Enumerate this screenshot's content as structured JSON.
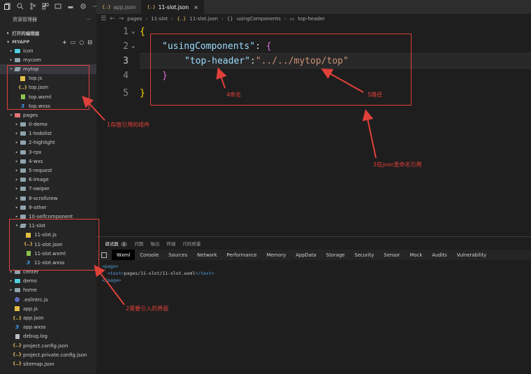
{
  "tabs": [
    {
      "label": "app.json",
      "active": false
    },
    {
      "label": "11-slot.json",
      "active": true
    }
  ],
  "tab_close_glyph": "×",
  "breadcrumb": [
    "pages",
    "11-slot",
    "11-slot.json",
    "usingComponents",
    "top-header"
  ],
  "sidebar": {
    "explorer_title": "资源管理器",
    "more_glyph": "···",
    "open_editors": "打开的编辑器",
    "project": "MYAPP",
    "tree": [
      {
        "label": "icon",
        "depth": 1,
        "kind": "folder-icon",
        "twist": "▸"
      },
      {
        "label": "mycom",
        "depth": 1,
        "kind": "folder",
        "twist": "▸"
      },
      {
        "label": "mytop",
        "depth": 1,
        "kind": "folder-open",
        "twist": "▾",
        "selected": true
      },
      {
        "label": "top.js",
        "depth": 2,
        "kind": "js",
        "twist": ""
      },
      {
        "label": "top.json",
        "depth": 2,
        "kind": "json",
        "twist": ""
      },
      {
        "label": "top.wxml",
        "depth": 2,
        "kind": "wxml",
        "twist": ""
      },
      {
        "label": "top.wxss",
        "depth": 2,
        "kind": "wxss",
        "twist": ""
      },
      {
        "label": "pages",
        "depth": 1,
        "kind": "folder-pages",
        "twist": "▾"
      },
      {
        "label": "0-demo",
        "depth": 2,
        "kind": "folder",
        "twist": "▸"
      },
      {
        "label": "1-todolist",
        "depth": 2,
        "kind": "folder",
        "twist": "▸"
      },
      {
        "label": "2-highlight",
        "depth": 2,
        "kind": "folder",
        "twist": "▸"
      },
      {
        "label": "3-rpx",
        "depth": 2,
        "kind": "folder",
        "twist": "▸"
      },
      {
        "label": "4-wxs",
        "depth": 2,
        "kind": "folder",
        "twist": "▸"
      },
      {
        "label": "5-request",
        "depth": 2,
        "kind": "folder",
        "twist": "▸"
      },
      {
        "label": "6-image",
        "depth": 2,
        "kind": "folder",
        "twist": "▸"
      },
      {
        "label": "7-swiper",
        "depth": 2,
        "kind": "folder",
        "twist": "▸"
      },
      {
        "label": "8-scrollview",
        "depth": 2,
        "kind": "folder",
        "twist": "▸"
      },
      {
        "label": "9-other",
        "depth": 2,
        "kind": "folder",
        "twist": "▸"
      },
      {
        "label": "10-selfcomponent",
        "depth": 2,
        "kind": "folder",
        "twist": "▸"
      },
      {
        "label": "11-slot",
        "depth": 2,
        "kind": "folder-open",
        "twist": "▾"
      },
      {
        "label": "11-slot.js",
        "depth": 3,
        "kind": "js",
        "twist": ""
      },
      {
        "label": "11-slot.json",
        "depth": 3,
        "kind": "json",
        "twist": ""
      },
      {
        "label": "11-slot.wxml",
        "depth": 3,
        "kind": "wxml",
        "twist": ""
      },
      {
        "label": "11-slot.wxss",
        "depth": 3,
        "kind": "wxss",
        "twist": ""
      },
      {
        "label": "center",
        "depth": 1,
        "kind": "folder",
        "twist": "▸"
      },
      {
        "label": "demo",
        "depth": 1,
        "kind": "folder-icon",
        "twist": "▸"
      },
      {
        "label": "home",
        "depth": 1,
        "kind": "folder",
        "twist": "▸"
      },
      {
        "label": ".eslintrc.js",
        "depth": 1,
        "kind": "eslint",
        "twist": ""
      },
      {
        "label": "app.js",
        "depth": 1,
        "kind": "js",
        "twist": ""
      },
      {
        "label": "app.json",
        "depth": 1,
        "kind": "json",
        "twist": ""
      },
      {
        "label": "app.wxss",
        "depth": 1,
        "kind": "wxss",
        "twist": ""
      },
      {
        "label": "debug.log",
        "depth": 1,
        "kind": "log",
        "twist": ""
      },
      {
        "label": "project.config.json",
        "depth": 1,
        "kind": "json",
        "twist": ""
      },
      {
        "label": "project.private.config.json",
        "depth": 1,
        "kind": "json",
        "twist": ""
      },
      {
        "label": "sitemap.json",
        "depth": 1,
        "kind": "json",
        "twist": ""
      }
    ]
  },
  "code": {
    "line_numbers": [
      "1",
      "2",
      "3",
      "4",
      "5"
    ],
    "open_brace": "{",
    "key": "\"usingComponents\"",
    "colon": ": ",
    "inner_open": "{",
    "inner_key": "\"top-header\"",
    "inner_colon": ":",
    "inner_value": "\"../../mytop/top\"",
    "inner_close": "}",
    "close_brace": "}"
  },
  "annotations": {
    "store": "1存放引用的组件",
    "page": "2需要引入的界面",
    "json_ref": "3在json里命名引用",
    "name": "4命名",
    "path": "5路径"
  },
  "devtools": {
    "top_tabs": [
      "调试器",
      "问题",
      "输出",
      "终端",
      "代码质量"
    ],
    "badge": "1",
    "panel_tabs": [
      "Wxml",
      "Console",
      "Sources",
      "Network",
      "Performance",
      "Memory",
      "AppData",
      "Storage",
      "Security",
      "Sensor",
      "Mock",
      "Audits",
      "Vulnerability"
    ],
    "dom": {
      "page_open": "<page>",
      "text_open": "<text>",
      "text_content": "pages/11-slot/11-slot.wxml",
      "text_close": "</text>",
      "page_close": "</page>"
    }
  },
  "json_glyph": "{..}",
  "colors": {
    "annotation": "#e8423a",
    "selection": "#37373d",
    "key": "#9cdcfe",
    "value": "#ce9178"
  }
}
